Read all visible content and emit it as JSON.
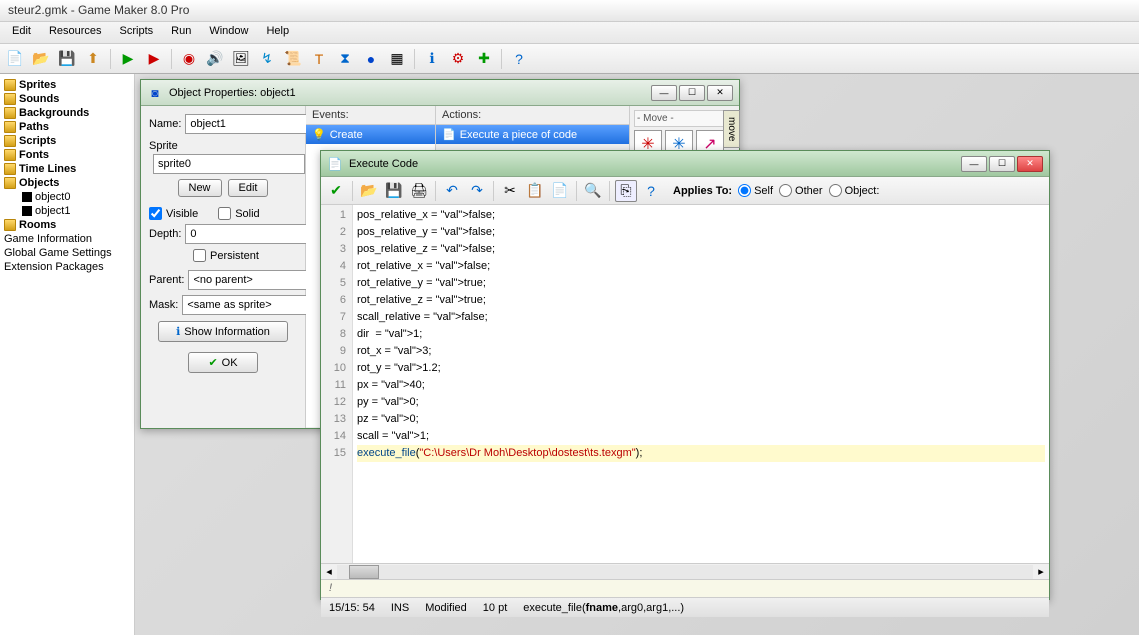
{
  "app": {
    "title": "steur2.gmk - Game Maker 8.0 Pro"
  },
  "menu": [
    "Edit",
    "Resources",
    "Scripts",
    "Run",
    "Window",
    "Help"
  ],
  "tree": {
    "folders": [
      "Sprites",
      "Sounds",
      "Backgrounds",
      "Paths",
      "Scripts",
      "Fonts",
      "Time Lines",
      "Objects",
      "Rooms"
    ],
    "objects": [
      "object0",
      "object1"
    ],
    "extras": [
      "Game Information",
      "Global Game Settings",
      "Extension Packages"
    ]
  },
  "objProp": {
    "title": "Object Properties: object1",
    "nameLabel": "Name:",
    "name": "object1",
    "spriteLabel": "Sprite",
    "sprite": "sprite0",
    "newBtn": "New",
    "editBtn": "Edit",
    "visible": "Visible",
    "solid": "Solid",
    "depthLabel": "Depth:",
    "depth": "0",
    "persistent": "Persistent",
    "parentLabel": "Parent:",
    "parent": "<no parent>",
    "maskLabel": "Mask:",
    "mask": "<same as sprite>",
    "showInfo": "Show Information",
    "ok": "OK",
    "eventsHdr": "Events:",
    "actionsHdr": "Actions:",
    "createEvent": "Create",
    "executeAction": "Execute a piece of code",
    "palTab": "move",
    "palHdr": "- Move -"
  },
  "codeWin": {
    "title": "Execute Code",
    "appliesTo": "Applies To:",
    "self": "Self",
    "other": "Other",
    "object": "Object:",
    "lines": [
      {
        "n": 1,
        "t": "pos_relative_x = false;"
      },
      {
        "n": 2,
        "t": "pos_relative_y = false;"
      },
      {
        "n": 3,
        "t": "pos_relative_z = false;"
      },
      {
        "n": 4,
        "t": "rot_relative_x = false;"
      },
      {
        "n": 5,
        "t": "rot_relative_y = true;"
      },
      {
        "n": 6,
        "t": "rot_relative_z = true;"
      },
      {
        "n": 7,
        "t": "scall_relative = false;"
      },
      {
        "n": 8,
        "t": "dir  = 1;"
      },
      {
        "n": 9,
        "t": "rot_x = 3;"
      },
      {
        "n": 10,
        "t": "rot_y = 1.2;"
      },
      {
        "n": 11,
        "t": "px = 40;"
      },
      {
        "n": 12,
        "t": "py = 0;"
      },
      {
        "n": 13,
        "t": "pz = 0;"
      },
      {
        "n": 14,
        "t": "scall = 1;"
      },
      {
        "n": 15,
        "t": "execute_file(\"C:\\Users\\Dr Moh\\Desktop\\dostest\\ts.texgm\");"
      }
    ],
    "hint": "!",
    "status": {
      "pos": "15/15:  54",
      "ins": "INS",
      "mod": "Modified",
      "pt": "10 pt",
      "fn": "execute_file(fname,arg0,arg1,...)"
    }
  }
}
